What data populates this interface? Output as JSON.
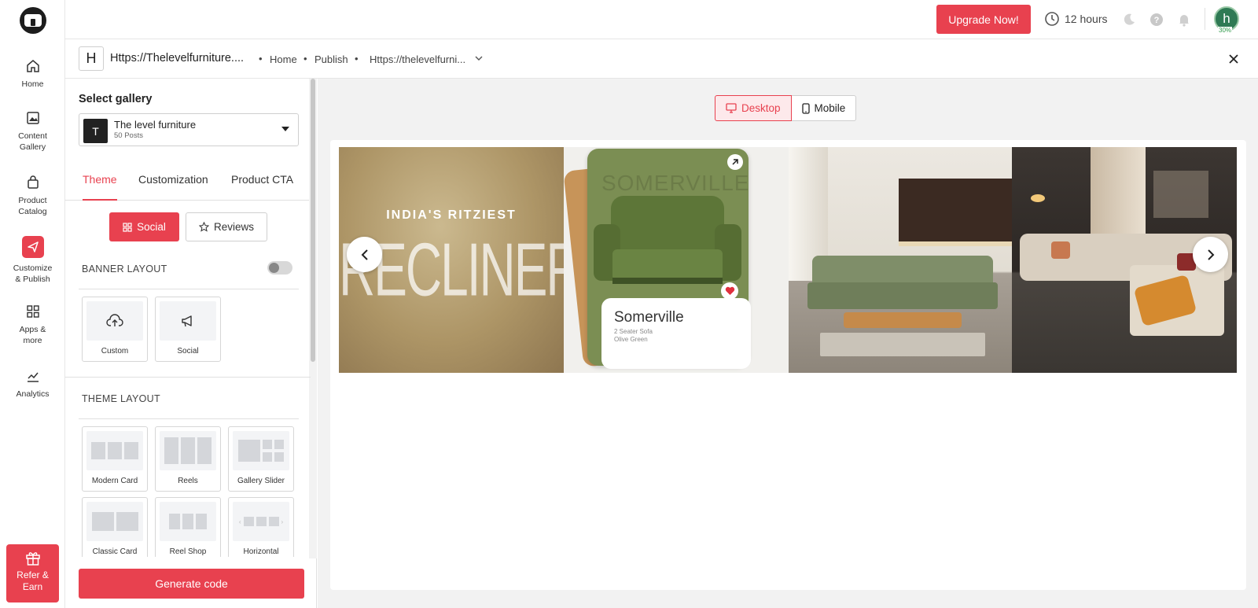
{
  "topbar": {
    "upgrade_label": "Upgrade Now!",
    "hours_label": "12 hours",
    "avatar_letter": "h",
    "avatar_progress": "30%"
  },
  "sidebar": {
    "items": [
      {
        "label": "Home",
        "icon": "home-icon"
      },
      {
        "label": "Content Gallery",
        "icon": "image-icon"
      },
      {
        "label": "Product Catalog",
        "icon": "bag-icon"
      },
      {
        "label": "Customize & Publish",
        "icon": "send-icon"
      },
      {
        "label": "Apps & more",
        "icon": "grid-icon"
      },
      {
        "label": "Analytics",
        "icon": "chart-icon"
      }
    ],
    "refer_label": "Refer & Earn"
  },
  "breadcrumb": {
    "site_initial": "H",
    "site_title": "Https://Thelevelfurniture....",
    "home": "Home",
    "publish": "Publish",
    "url": "Https://thelevelfurni..."
  },
  "panel": {
    "select_gallery_label": "Select gallery",
    "gallery": {
      "initial": "T",
      "name": "The level furniture",
      "posts": "50 Posts"
    },
    "tabs": [
      "Theme",
      "Customization",
      "Product CTA"
    ],
    "social_label": "Social",
    "reviews_label": "Reviews",
    "banner_layout_title": "BANNER LAYOUT",
    "banner_options": [
      "Custom",
      "Social"
    ],
    "theme_layout_title": "THEME LAYOUT",
    "theme_options": [
      "Modern Card",
      "Reels",
      "Gallery Slider",
      "Classic Card",
      "Reel Shop",
      "Horizontal"
    ],
    "generate_label": "Generate code"
  },
  "preview": {
    "desktop_label": "Desktop",
    "mobile_label": "Mobile",
    "slide1_kicker": "INDIA'S RITZIEST",
    "slide1_title": "RECLINERS",
    "slide2_name": "Somerville",
    "slide2_line1": "2 Seater Sofa",
    "slide2_line2": "Olive Green"
  },
  "colors": {
    "accent": "#e8414f",
    "avatar": "#2f7a54"
  }
}
